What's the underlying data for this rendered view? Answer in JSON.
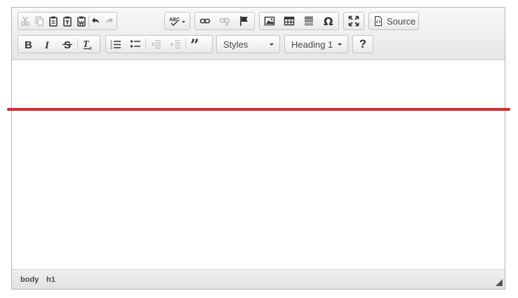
{
  "toolbar": {
    "source_label": "Source",
    "styles_value": "Styles",
    "format_value": "Heading 1",
    "help_label": "?"
  },
  "statusbar": {
    "path": [
      "body",
      "h1"
    ]
  },
  "accent": {
    "divider_color": "#d9262e"
  }
}
